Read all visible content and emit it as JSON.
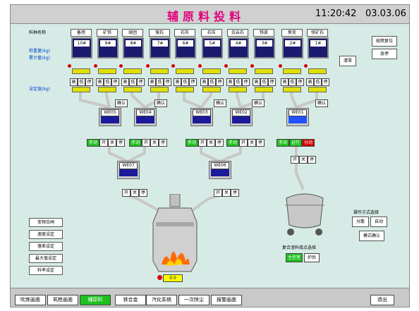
{
  "header": {
    "title": "辅原料投料",
    "time": "11:20:42",
    "date": "03.03.06"
  },
  "left_labels": {
    "material_name": "料种名称",
    "ratio": "称重量(kg)",
    "total": "累计量(kg)",
    "setpoint": "设定值(kg)"
  },
  "materials": [
    {
      "name": "备用",
      "bin": "10#"
    },
    {
      "name": "矿铁",
      "bin": "9#"
    },
    {
      "name": "球团",
      "bin": "8#"
    },
    {
      "name": "萤石",
      "bin": "7#"
    },
    {
      "name": "石灰",
      "bin": "6#"
    },
    {
      "name": "石灰",
      "bin": "5#"
    },
    {
      "name": "白云石",
      "bin": "4#"
    },
    {
      "name": "铁皮",
      "bin": "3#"
    },
    {
      "name": "焦炭",
      "bin": "2#"
    },
    {
      "name": "铁矿石",
      "bin": "1#"
    }
  ],
  "feeder": {
    "high": "高",
    "low": "低",
    "stop": "停"
  },
  "confirm_label": "确认",
  "hoppers": {
    "we05": "WE05",
    "we04": "WE04",
    "we03": "WE03",
    "we02": "WE02",
    "we01": "WE01",
    "we07": "WE07",
    "we06": "WE06"
  },
  "ops": {
    "manual": "手动",
    "open": "开",
    "close": "关",
    "stop": "停",
    "running": "运行",
    "dist": "分动"
  },
  "right_panel": {
    "reset": "故障复位",
    "estop": "急停",
    "clear": "清零",
    "op_mode": "操作方式选择",
    "split": "分散",
    "auto": "自动",
    "mode_confirm": "模式确认"
  },
  "side_buttons": [
    "变频合闸",
    "速度设定",
    "落差设定",
    "最大值设定",
    "料率设定"
  ],
  "ladle": {
    "caption": "复合渣料接点选择",
    "btn1": "主控室",
    "btn2": "炉后"
  },
  "converter": {
    "readout": "0.0"
  },
  "nav": {
    "items": [
      "吹炼画面",
      "氧枪画面",
      "辅原料",
      "铁合金",
      "汽化系统",
      "一次除尘",
      "报警画面"
    ],
    "active_index": 2,
    "exit": "退出"
  }
}
